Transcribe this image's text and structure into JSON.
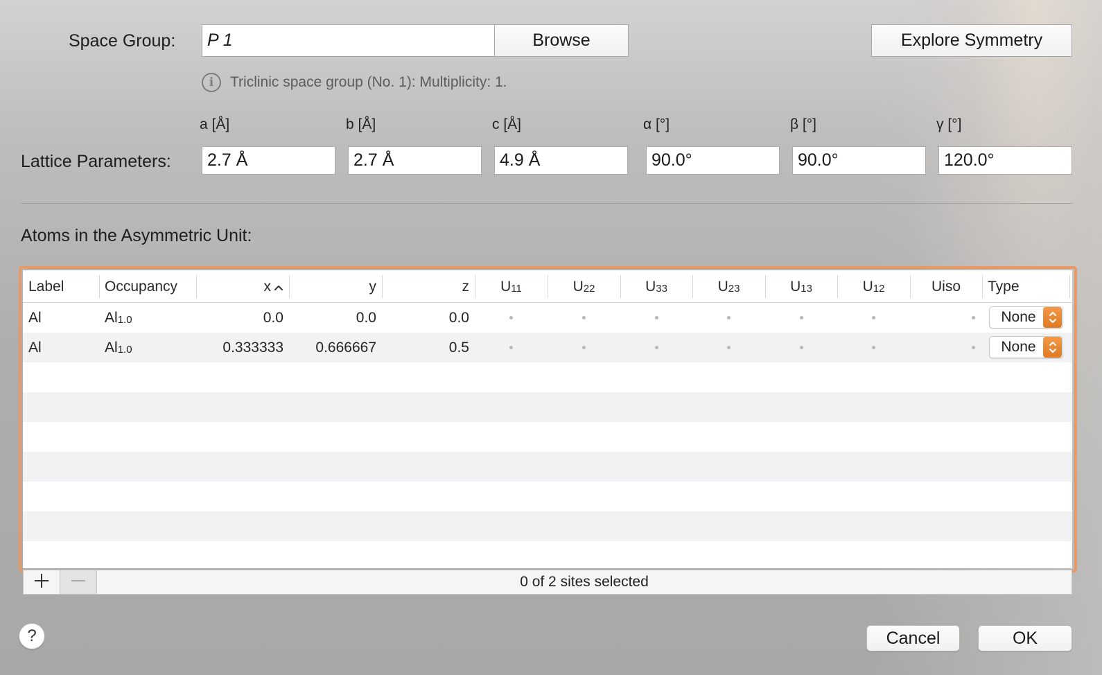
{
  "space_group": {
    "label": "Space Group:",
    "value": "P 1",
    "browse_label": "Browse",
    "explore_label": "Explore Symmetry",
    "info_text": "Triclinic space group (No. 1): Multiplicity: 1."
  },
  "lattice": {
    "label": "Lattice Parameters:",
    "params": [
      {
        "name": "a [Å]",
        "value": "2.7 Å"
      },
      {
        "name": "b [Å]",
        "value": "2.7 Å"
      },
      {
        "name": "c [Å]",
        "value": "4.9 Å"
      },
      {
        "name": "α [°]",
        "value": "90.0°"
      },
      {
        "name": "β [°]",
        "value": "90.0°"
      },
      {
        "name": "γ [°]",
        "value": "120.0°"
      }
    ]
  },
  "atoms": {
    "title": "Atoms in the Asymmetric Unit:",
    "columns": {
      "label": "Label",
      "occupancy": "Occupancy",
      "x": "x",
      "y": "y",
      "z": "z",
      "u11": "11",
      "u22": "22",
      "u33": "33",
      "u23": "23",
      "u13": "13",
      "u12": "12",
      "u_letter": "U",
      "uiso": "Uiso",
      "type": "Type"
    },
    "rows": [
      {
        "label": "Al",
        "occ_el": "Al",
        "occ_val": "1.0",
        "x": "0.0",
        "y": "0.0",
        "z": "0.0",
        "type": "None"
      },
      {
        "label": "Al",
        "occ_el": "Al",
        "occ_val": "1.0",
        "x": "0.333333",
        "y": "0.666667",
        "z": "0.5",
        "type": "None"
      }
    ],
    "status": "0 of 2 sites selected",
    "sort_column": "x",
    "sort_direction": "ascending"
  },
  "dialog": {
    "cancel_label": "Cancel",
    "ok_label": "OK",
    "help_label": "?"
  },
  "colors": {
    "focus_ring": "#e59a68",
    "popup_accent": "#e07a22",
    "alt_row": "#f2f2f4"
  }
}
